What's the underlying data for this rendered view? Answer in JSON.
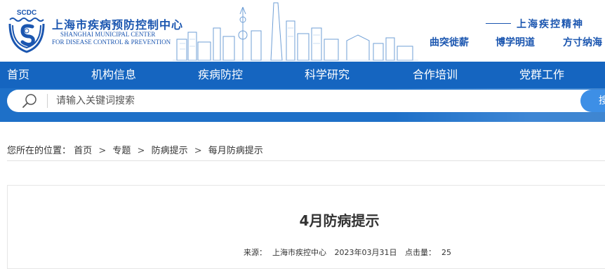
{
  "header": {
    "logo_text": "SCDC",
    "site_title": "上海市疾病预防控制中心",
    "site_title_en_line1": "SHANGHAI MUNICIPAL CENTER",
    "site_title_en_line2": "FOR DISEASE CONTROL & PREVENTION",
    "spirit_title": "上海疾控精神",
    "mottos": [
      "曲突徙薪",
      "博学明道",
      "方寸纳海"
    ]
  },
  "nav": {
    "items": [
      "首页",
      "机构信息",
      "疾病防控",
      "科学研究",
      "合作培训",
      "党群工作"
    ]
  },
  "search": {
    "placeholder": "请输入关键词搜索",
    "button_label": "搜"
  },
  "breadcrumb": {
    "prefix": "您所在的位置：",
    "items": [
      "首页",
      "专题",
      "防病提示",
      "每月防病提示"
    ],
    "separator": ">"
  },
  "article": {
    "title": "4月防病提示",
    "source_label": "来源：",
    "source": "上海市疾控中心",
    "date": "2023年03月31日",
    "views_label": "点击量：",
    "views": "25"
  },
  "colors": {
    "brand_blue": "#1b56b0",
    "nav_bg": "#1565c0",
    "search_band": "#1e70c8"
  }
}
